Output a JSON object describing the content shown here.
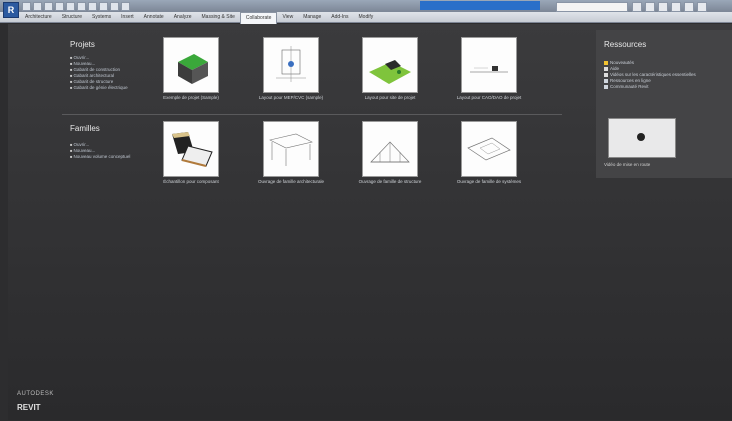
{
  "app": {
    "button_label": "R",
    "name": "AUTODESK",
    "product": "REVIT"
  },
  "ribbon": {
    "tabs": [
      "Architecture",
      "Structure",
      "Systems",
      "Insert",
      "Annotate",
      "Analyze",
      "Massing & Site",
      "Collaborate",
      "View",
      "Manage",
      "Add-Ins",
      "Modify"
    ],
    "active_index": 7
  },
  "projects": {
    "title": "Projets",
    "links": [
      "Ouvrir...",
      "Nouveau...",
      "Gabarit de construction",
      "Gabarit architectural",
      "Gabarit de structure",
      "Gabarit de génie électrique"
    ],
    "tiles": [
      {
        "caption": "Exemple de projet (Sample)",
        "icon": "house-model-icon"
      },
      {
        "caption": "Layout pour MEP/CVC (sample)",
        "icon": "mep-plan-icon"
      },
      {
        "caption": "Layout pour site de projet",
        "icon": "site-model-icon"
      },
      {
        "caption": "Layout pour CAO/DAO de projet",
        "icon": "cad-layout-icon"
      }
    ]
  },
  "families": {
    "title": "Familles",
    "links": [
      "Ouvrir...",
      "Nouveau...",
      "Nouveau volume conceptuel"
    ],
    "tiles": [
      {
        "caption": "Échantillon pour composant",
        "icon": "bench-family-icon"
      },
      {
        "caption": "Ouvrage de famille architecturale",
        "icon": "table-family-icon"
      },
      {
        "caption": "Ouvrage de famille de structure",
        "icon": "truss-family-icon"
      },
      {
        "caption": "Ouvrage de famille de systèmes",
        "icon": "plate-family-icon"
      }
    ]
  },
  "resources": {
    "title": "Ressources",
    "links": [
      "Nouveautés",
      "Aide",
      "Vidéos sur les caractéristiques essentielles",
      "Ressources en ligne",
      "Communauté Revit"
    ],
    "video_caption": "Vidéo de mise en route"
  }
}
